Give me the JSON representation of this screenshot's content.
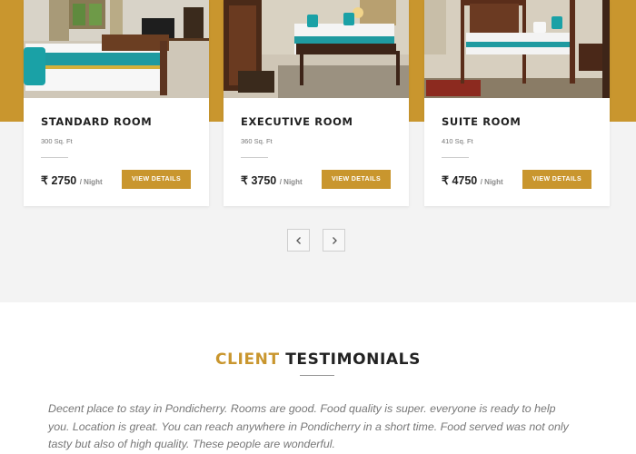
{
  "rooms": [
    {
      "name": "STANDARD ROOM",
      "size": "300 Sq. Ft",
      "currency": "₹",
      "price": "2750",
      "per": "/ Night",
      "button": "VIEW DETAILS"
    },
    {
      "name": "EXECUTIVE ROOM",
      "size": "360 Sq. Ft",
      "currency": "₹",
      "price": "3750",
      "per": "/ Night",
      "button": "VIEW DETAILS"
    },
    {
      "name": "SUITE ROOM",
      "size": "410 Sq. Ft",
      "currency": "₹",
      "price": "4750",
      "per": "/ Night",
      "button": "VIEW DETAILS"
    }
  ],
  "carousel": {
    "prev_icon": "chevron-left-icon",
    "next_icon": "chevron-right-icon"
  },
  "testimonials": {
    "title_highlight": "CLIENT",
    "title_rest": "TESTIMONIALS",
    "quote": "Decent place to stay in Pondicherry. Rooms are good. Food quality is super. everyone is ready to help you. Location is great. You can reach anywhere in Pondicherry in a short time. Food served was not only tasty but also of high quality. These people are wonderful."
  },
  "colors": {
    "accent": "#c9962e",
    "section_bg": "#f3f3f3",
    "text_dark": "#222222",
    "text_muted": "#777777"
  }
}
